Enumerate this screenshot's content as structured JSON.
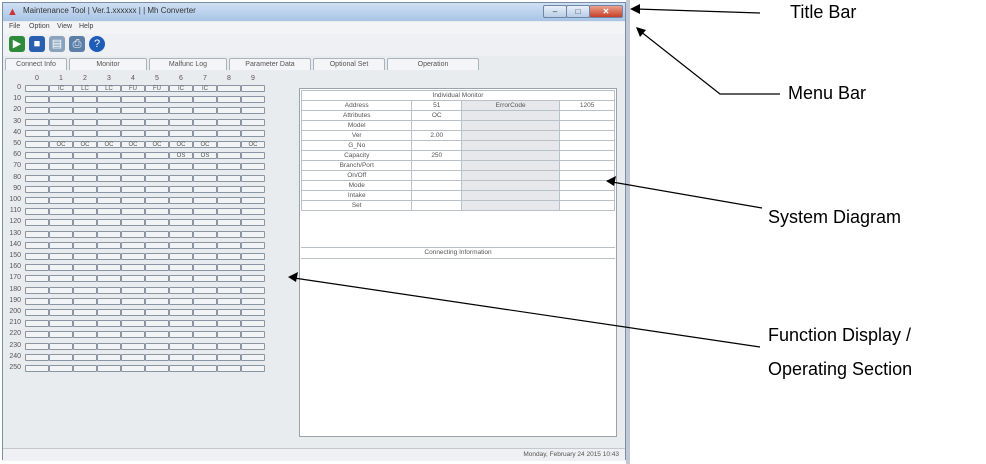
{
  "window": {
    "title": "Maintenance Tool | Ver.1.xxxxxx | | Mh Converter",
    "controls": {
      "minimize": "–",
      "maximize": "□",
      "close": "✕"
    }
  },
  "menu": [
    "File",
    "Option",
    "View",
    "Help"
  ],
  "toolbar": [
    "connect-icon",
    "save-icon",
    "open-icon",
    "print-icon",
    "help-icon"
  ],
  "tabs": [
    "Connect Info",
    "Monitor",
    "Malfunc Log",
    "Parameter Data",
    "Optional Set",
    "Operation"
  ],
  "grid": {
    "columns": [
      "0",
      "1",
      "2",
      "3",
      "4",
      "5",
      "6",
      "7",
      "8",
      "9"
    ],
    "rows": [
      {
        "label": "0",
        "cells": [
          "",
          "IC",
          "LC",
          "LC",
          "FU",
          "FU",
          "IC",
          "IC",
          "",
          ""
        ]
      },
      {
        "label": "10",
        "cells": [
          "",
          "",
          "",
          "",
          "",
          "",
          "",
          "",
          "",
          ""
        ]
      },
      {
        "label": "20",
        "cells": [
          "",
          "",
          "",
          "",
          "",
          "",
          "",
          "",
          "",
          ""
        ]
      },
      {
        "label": "30",
        "cells": [
          "",
          "",
          "",
          "",
          "",
          "",
          "",
          "",
          "",
          ""
        ]
      },
      {
        "label": "40",
        "cells": [
          "",
          "",
          "",
          "",
          "",
          "",
          "",
          "",
          "",
          ""
        ]
      },
      {
        "label": "50",
        "cells": [
          "",
          "OC",
          "OC",
          "OC",
          "OC",
          "OC",
          "OC",
          "OC",
          "",
          "OC"
        ]
      },
      {
        "label": "60",
        "cells": [
          "",
          "",
          "",
          "",
          "",
          "",
          "OS",
          "OS",
          "",
          ""
        ]
      },
      {
        "label": "70",
        "cells": [
          "",
          "",
          "",
          "",
          "",
          "",
          "",
          "",
          "",
          ""
        ]
      },
      {
        "label": "80",
        "cells": [
          "",
          "",
          "",
          "",
          "",
          "",
          "",
          "",
          "",
          ""
        ]
      },
      {
        "label": "90",
        "cells": [
          "",
          "",
          "",
          "",
          "",
          "",
          "",
          "",
          "",
          ""
        ]
      },
      {
        "label": "100",
        "cells": [
          "",
          "",
          "",
          "",
          "",
          "",
          "",
          "",
          "",
          ""
        ]
      },
      {
        "label": "110",
        "cells": [
          "",
          "",
          "",
          "",
          "",
          "",
          "",
          "",
          "",
          ""
        ]
      },
      {
        "label": "120",
        "cells": [
          "",
          "",
          "",
          "",
          "",
          "",
          "",
          "",
          "",
          ""
        ]
      },
      {
        "label": "130",
        "cells": [
          "",
          "",
          "",
          "",
          "",
          "",
          "",
          "",
          "",
          ""
        ]
      },
      {
        "label": "140",
        "cells": [
          "",
          "",
          "",
          "",
          "",
          "",
          "",
          "",
          "",
          ""
        ]
      },
      {
        "label": "150",
        "cells": [
          "",
          "",
          "",
          "",
          "",
          "",
          "",
          "",
          "",
          ""
        ]
      },
      {
        "label": "160",
        "cells": [
          "",
          "",
          "",
          "",
          "",
          "",
          "",
          "",
          "",
          ""
        ]
      },
      {
        "label": "170",
        "cells": [
          "",
          "",
          "",
          "",
          "",
          "",
          "",
          "",
          "",
          ""
        ]
      },
      {
        "label": "180",
        "cells": [
          "",
          "",
          "",
          "",
          "",
          "",
          "",
          "",
          "",
          ""
        ]
      },
      {
        "label": "190",
        "cells": [
          "",
          "",
          "",
          "",
          "",
          "",
          "",
          "",
          "",
          ""
        ]
      },
      {
        "label": "200",
        "cells": [
          "",
          "",
          "",
          "",
          "",
          "",
          "",
          "",
          "",
          ""
        ]
      },
      {
        "label": "210",
        "cells": [
          "",
          "",
          "",
          "",
          "",
          "",
          "",
          "",
          "",
          ""
        ]
      },
      {
        "label": "220",
        "cells": [
          "",
          "",
          "",
          "",
          "",
          "",
          "",
          "",
          "",
          ""
        ]
      },
      {
        "label": "230",
        "cells": [
          "",
          "",
          "",
          "",
          "",
          "",
          "",
          "",
          "",
          ""
        ]
      },
      {
        "label": "240",
        "cells": [
          "",
          "",
          "",
          "",
          "",
          "",
          "",
          "",
          "",
          ""
        ]
      },
      {
        "label": "250",
        "cells": [
          "",
          "",
          "",
          "",
          "",
          "",
          "",
          "",
          "",
          ""
        ]
      }
    ]
  },
  "monitor": {
    "title": "Individual Monitor",
    "rows": [
      {
        "label": "Address",
        "value": "51",
        "label2": "ErrorCode",
        "value2": "1205"
      },
      {
        "label": "Attributes",
        "value": "OC",
        "label2": "",
        "value2": ""
      },
      {
        "label": "Model",
        "value": "",
        "label2": "",
        "value2": ""
      },
      {
        "label": "Ver",
        "value": "2.00",
        "label2": "",
        "value2": ""
      },
      {
        "label": "G_No",
        "value": "",
        "label2": "",
        "value2": ""
      },
      {
        "label": "Capacity",
        "value": "250",
        "label2": "",
        "value2": ""
      },
      {
        "label": "Branch/Port",
        "value": "",
        "label2": "",
        "value2": ""
      },
      {
        "label": "On/Off",
        "value": "",
        "label2": "",
        "value2": ""
      },
      {
        "label": "Mode",
        "value": "",
        "label2": "",
        "value2": ""
      },
      {
        "label": "Intake",
        "value": "",
        "label2": "",
        "value2": ""
      },
      {
        "label": "Set",
        "value": "",
        "label2": "",
        "value2": ""
      }
    ],
    "connecting_info_title": "Connecting Information"
  },
  "status": "Monday, February 24 2015 10:43",
  "callouts": {
    "title_bar": "Title Bar",
    "menu_bar": "Menu Bar",
    "system_diagram": "System Diagram",
    "function_display_1": "Function Display /",
    "function_display_2": "Operating Section"
  },
  "colors": {
    "titlebar": "#a9c4e6",
    "close": "#c8412a",
    "toolbar_green": "#2e8b3a",
    "toolbar_blue": "#2a5fb0"
  }
}
